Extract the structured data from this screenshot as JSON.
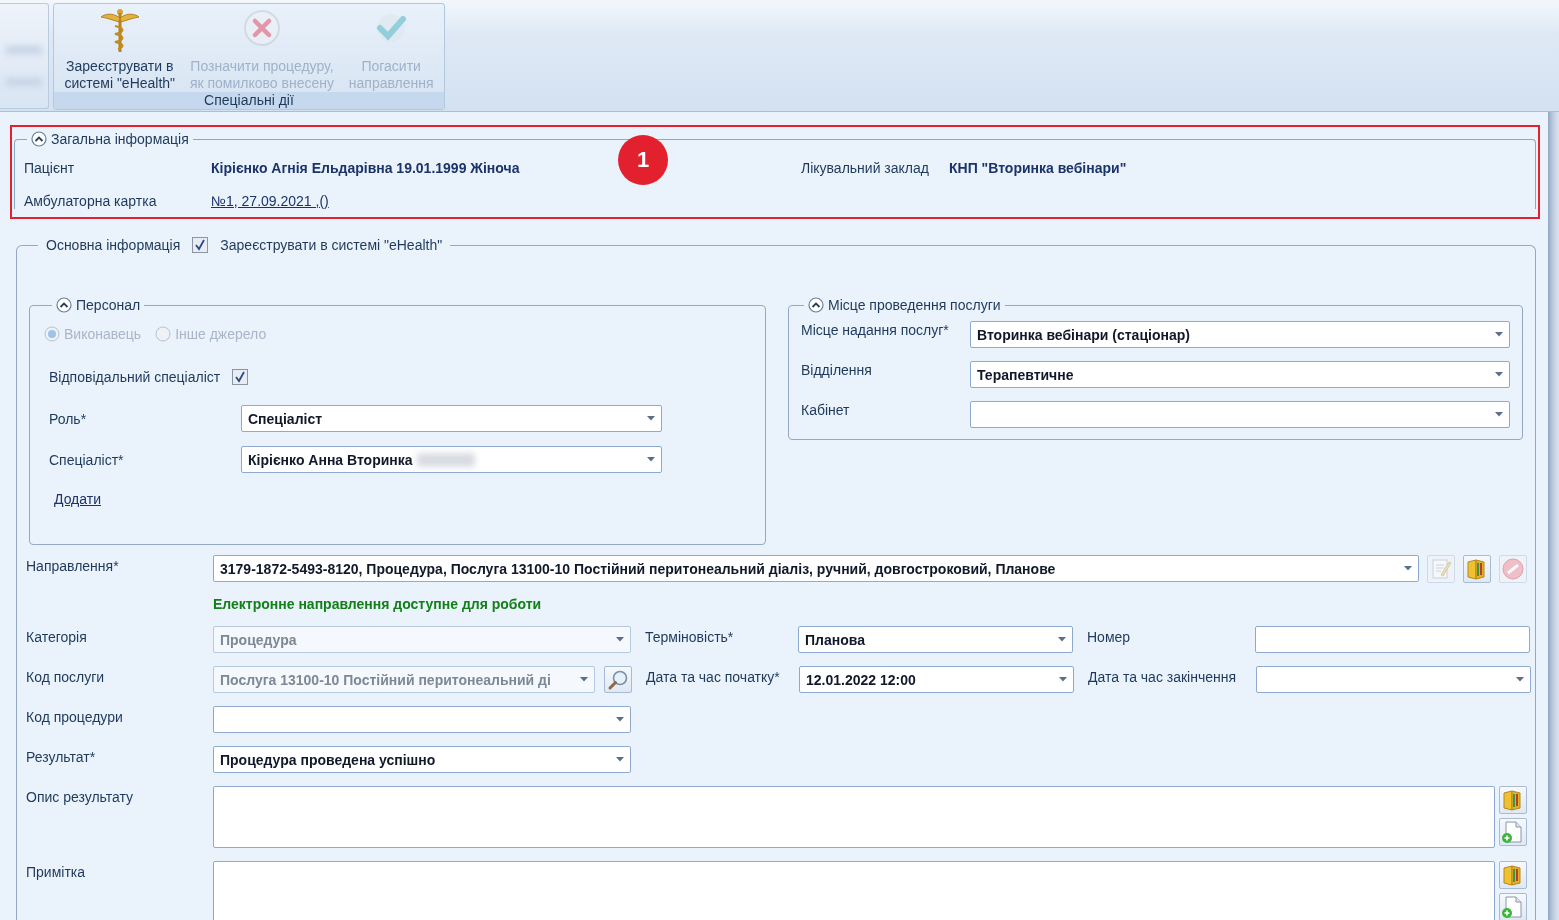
{
  "ribbon": {
    "group_label": "Спеціальні дії",
    "buttons": [
      {
        "label": "Зареєструвати в\nсистемі \"eHealth\"",
        "disabled": false
      },
      {
        "label": "Позначити процедуру,\nяк помилково внесену",
        "disabled": true
      },
      {
        "label": "Погасити\nнаправлення",
        "disabled": true
      }
    ]
  },
  "annotation": {
    "number": "1"
  },
  "general_info": {
    "title": "Загальна інформація",
    "expanded": true,
    "patient": {
      "label": "Пацієнт",
      "value": "Кірієнко Агнія Ельдарівна 19.01.1999 Жіноча"
    },
    "facility": {
      "label": "Лікувальний заклад",
      "value": "КНП \"Вторинка вебінари\""
    },
    "card": {
      "label": "Амбулаторна картка",
      "value": "№1, 27.09.2021 ,()"
    }
  },
  "main_info": {
    "title": "Основна інформація",
    "ehealth": {
      "label": "Зареєструвати в системі \"eHealth\"",
      "checked": true
    }
  },
  "personnel": {
    "title": "Персонал",
    "expanded": true,
    "radios_disabled": true,
    "radios": [
      {
        "label": "Виконавець",
        "selected": true
      },
      {
        "label": "Інше джерело",
        "selected": false
      }
    ],
    "responsible": {
      "label": "Відповідальний спеціаліст",
      "checked": true
    },
    "role": {
      "label": "Роль*",
      "value": "Спеціаліст"
    },
    "specialist": {
      "label": "Спеціаліст*",
      "value": "Кірієнко Анна Вторинка",
      "redacted": true
    },
    "add_link": "Додати"
  },
  "location": {
    "title": "Місце проведення послуги",
    "expanded": true,
    "fields": [
      {
        "label": "Місце надання послуг*",
        "value": "Вторинка вебінари (стаціонар)"
      },
      {
        "label": "Відділення",
        "value": "Терапевтичне"
      },
      {
        "label": "Кабінет"
      }
    ]
  },
  "referral": {
    "label": "Направлення*",
    "value": "3179-1872-5493-8120, Процедура, Послуга 13100-10 Постійний перитонеальний діаліз, ручний, довгостроковий, Планове",
    "status": "Електронне направлення доступне для роботи",
    "actions": [
      {
        "disabled": true
      },
      {
        "disabled": false
      },
      {
        "disabled": true
      }
    ]
  },
  "category": {
    "label": "Категорія",
    "value": "Процедура",
    "disabled": true
  },
  "urgency": {
    "label": "Терміновість*",
    "value": "Планова"
  },
  "number": {
    "label": "Номер"
  },
  "service_code": {
    "label": "Код послуги",
    "value": "Послуга 13100-10 Постійний перитонеальний ді",
    "disabled": true
  },
  "start": {
    "label": "Дата та час початку*",
    "value": "12.01.2022 12:00"
  },
  "end": {
    "label": "Дата та час закінчення"
  },
  "procedure_code": {
    "label": "Код процедури"
  },
  "result": {
    "label": "Результат*",
    "value": "Процедура проведена успішно"
  },
  "result_description": {
    "label": "Опис результату"
  },
  "note": {
    "label": "Примітка"
  }
}
